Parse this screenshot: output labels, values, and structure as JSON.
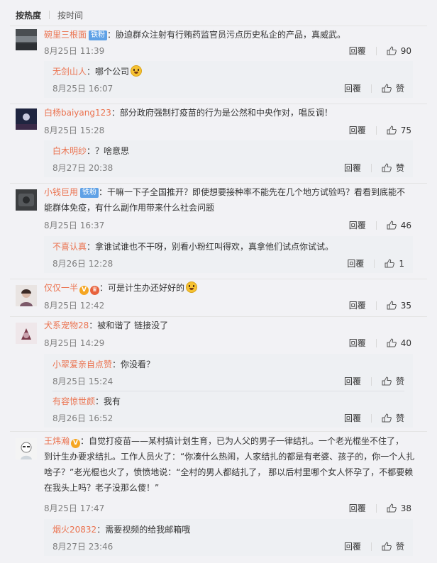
{
  "sort": {
    "by_hot": "按热度",
    "by_time": "按时间"
  },
  "comments": [
    {
      "user": "碗里三根面",
      "badge": "铁粉",
      "text": "：胁迫群众注射有行贿药监官员污点历史私企的产品，真威武。",
      "date": "8月25日 11:39",
      "reply_label": "回覆",
      "likes": "90",
      "replies": [
        {
          "user": "无剑山人",
          "text": "：哪个公司",
          "date": "8月25日 16:07",
          "reply_label": "回覆",
          "likes": "赞"
        }
      ]
    },
    {
      "user": "白杨baiyang123",
      "text": "：部分政府强制打疫苗的行为是公然和中央作对，唱反调！",
      "date": "8月25日 15:28",
      "reply_label": "回覆",
      "likes": "75",
      "replies": [
        {
          "user": "白木明纱",
          "text": "：？啥意思",
          "date": "8月27日 20:38",
          "reply_label": "回覆",
          "likes": "赞"
        }
      ]
    },
    {
      "user": "小钱巨用",
      "badge": "铁粉",
      "text_line1": "：干嘛一下子全国推开？即使想要接种率不能先在几个地方试验吗？看看到底能不",
      "text_line2": "能群体免疫，有什么副作用带来什么社会问题",
      "date": "8月25日 16:37",
      "reply_label": "回覆",
      "likes": "46",
      "replies": [
        {
          "user": "不喜认真",
          "text": "：拿谁试谁也不干呀，别看小粉红叫得欢，真拿他们试点你试试。",
          "date": "8月26日 12:28",
          "reply_label": "回覆",
          "likes": "1"
        }
      ]
    },
    {
      "user": "仅仅一半",
      "text": "：可是计生办还好好的",
      "date": "8月25日 12:42",
      "reply_label": "回覆",
      "likes": "35"
    },
    {
      "user": "犬系宠物28",
      "text": "：被和谐了 链接没了",
      "date": "8月25日 14:29",
      "reply_label": "回覆",
      "likes": "40",
      "replies": [
        {
          "user": "小翠爱亲自点赞",
          "text": "：你没看？",
          "date": "8月25日 15:24",
          "reply_label": "回覆",
          "likes": "赞"
        },
        {
          "user": "有容惊世颜",
          "text": "：我有",
          "date": "8月26日 16:52",
          "reply_label": "回覆",
          "likes": "赞"
        }
      ]
    },
    {
      "user": "王炜瀚",
      "text_line1": "：自觉打疫苗——某村搞计划生育，已为人父的男子一律结扎。一个老光棍坐不住了，",
      "text_line2": "到计生办要求结扎。工作人员火了：“你凑什么热闹，人家结扎的都是有老婆、孩子的，你一个人扎",
      "text_line3": "啥子？”老光棍也火了，愤愤地说：“全村的男人都结扎了， 那以后村里哪个女人怀孕了，不都要赖",
      "text_line4": "在我头上吗？老子没那么傻！”",
      "date": "8月25日 17:47",
      "reply_label": "回覆",
      "likes": "38",
      "replies": [
        {
          "user": "烟火20832",
          "text": "：需要视频的给我邮箱哦",
          "date": "8月27日 23:46",
          "reply_label": "回覆",
          "likes": "赞"
        }
      ]
    }
  ]
}
